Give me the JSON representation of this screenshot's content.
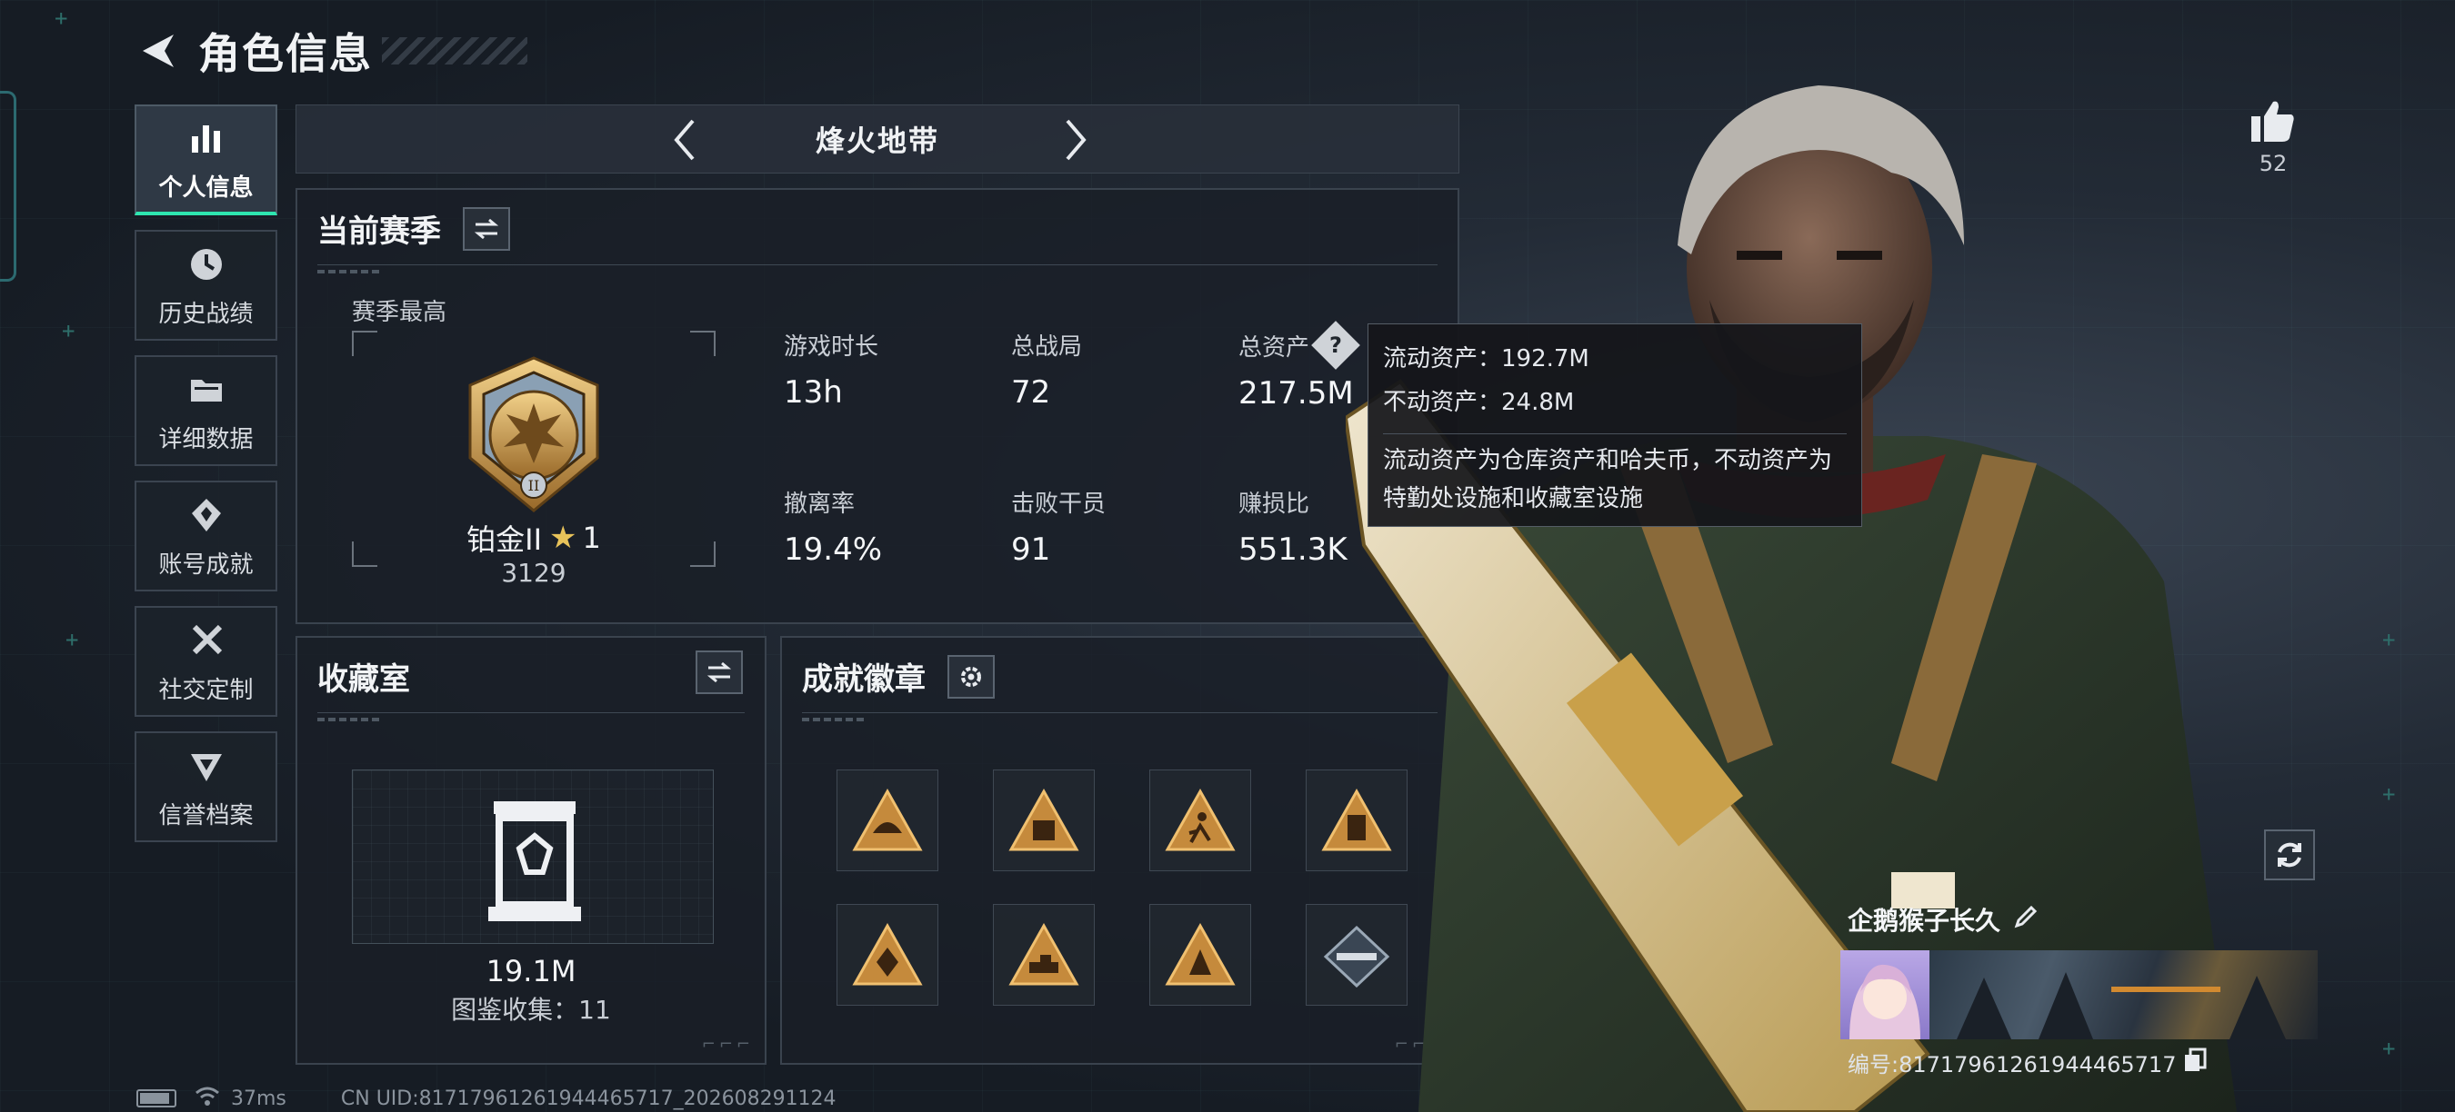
{
  "header": {
    "title": "角色信息"
  },
  "sidebar": {
    "items": [
      {
        "label": "个人信息",
        "icon": "bar-chart-icon",
        "active": true
      },
      {
        "label": "历史战绩",
        "icon": "history-icon",
        "active": false
      },
      {
        "label": "详细数据",
        "icon": "folder-icon",
        "active": false
      },
      {
        "label": "账号成就",
        "icon": "achievement-icon",
        "active": false
      },
      {
        "label": "社交定制",
        "icon": "tools-icon",
        "active": false
      },
      {
        "label": "信誉档案",
        "icon": "reputation-icon",
        "active": false
      }
    ]
  },
  "mode": {
    "title": "烽火地带"
  },
  "season": {
    "title": "当前赛季",
    "best_label": "赛季最高",
    "rank": {
      "name": "铂金II",
      "stars": "1",
      "score": "3129"
    },
    "stats": [
      {
        "label": "游戏时长",
        "value": "13h"
      },
      {
        "label": "总战局",
        "value": "72"
      },
      {
        "label": "总资产",
        "value": "217.5M",
        "help": "?"
      },
      {
        "label": "撤离率",
        "value": "19.4%"
      },
      {
        "label": "击败干员",
        "value": "91"
      },
      {
        "label": "赚损比",
        "value": "551.3K"
      }
    ]
  },
  "tooltip": {
    "line1": "流动资产：192.7M",
    "line2": "不动资产：24.8M",
    "desc": "流动资产为仓库资产和哈夫币，不动资产为特勤处设施和收藏室设施"
  },
  "collection": {
    "title": "收藏室",
    "value": "19.1M",
    "count": "图鉴收集：11"
  },
  "badges": {
    "title": "成就徽章",
    "items": [
      "helmet-badge-icon",
      "crate-badge-icon",
      "runner-badge-icon",
      "document-badge-icon",
      "diamond-badge-icon",
      "tank-badge-icon",
      "soldier-badge-icon",
      "rifle-badge-icon"
    ]
  },
  "likes": {
    "count": "52"
  },
  "profile": {
    "nickname": "企鹅猴子长久",
    "id_text": "编号:8171796126194446571​7"
  },
  "status": {
    "ping": "37ms",
    "uid": "CN UID:8171796126194446571​7_202608291124"
  },
  "colors": {
    "accent": "#2ee6b0",
    "gold": "#c9a04a",
    "panel_border": "#3a434e"
  }
}
